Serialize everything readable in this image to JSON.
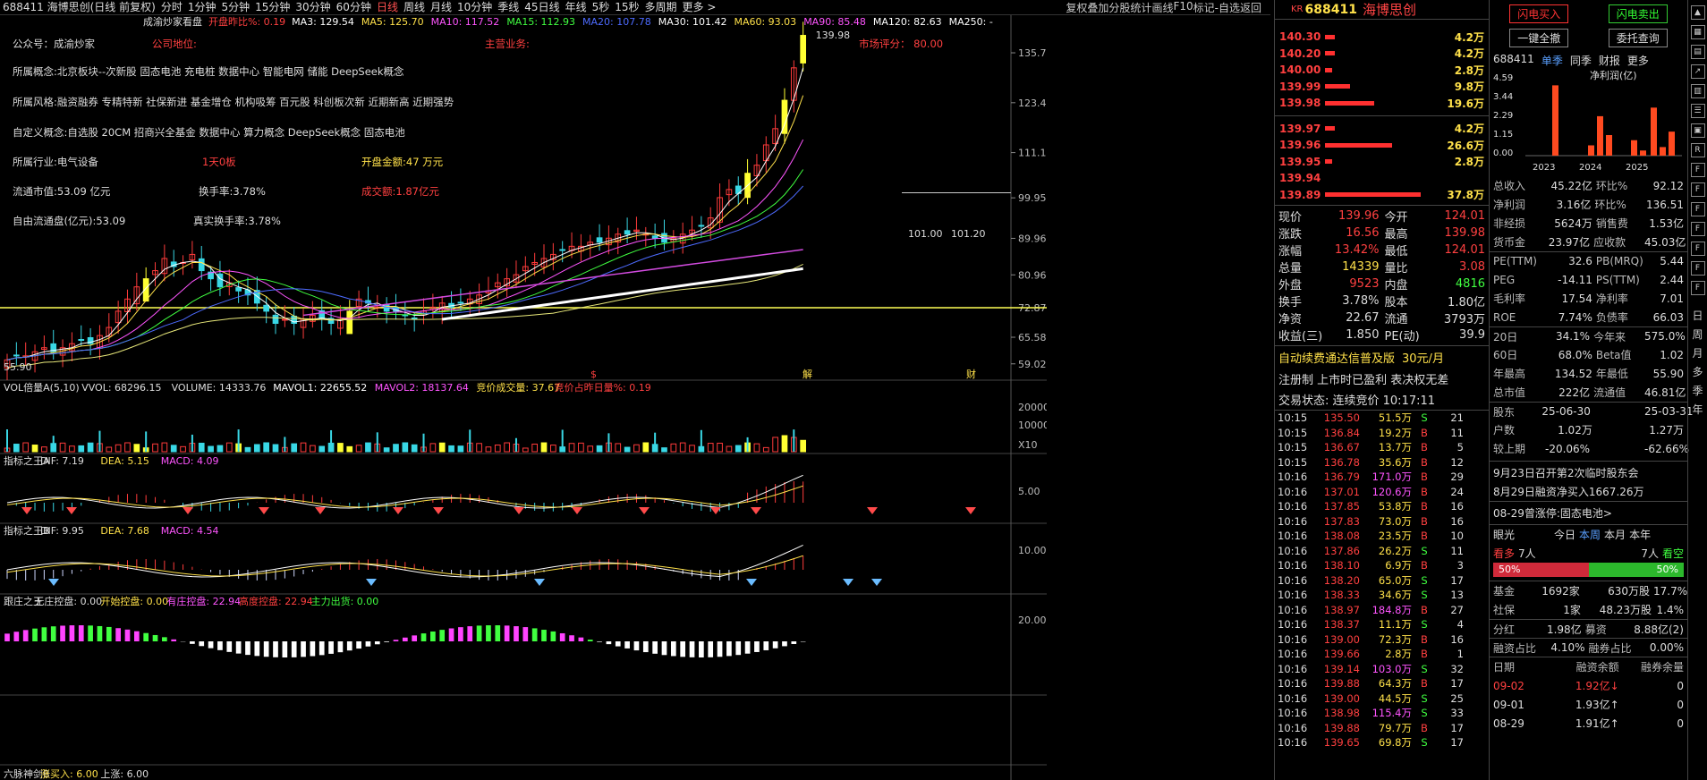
{
  "topbar": {
    "title": "688411 海博思创(日线 前复权)",
    "periods": [
      "分时",
      "1分钟",
      "5分钟",
      "15分钟",
      "30分钟",
      "60分钟",
      "日线",
      "周线",
      "月线",
      "10分钟",
      "季线",
      "45日线",
      "年线",
      "5秒",
      "15秒",
      "多周期",
      "更多 >"
    ],
    "active_period": "日线",
    "buttons": [
      "复权",
      "叠加",
      "分股",
      "统计",
      "画线",
      "F10",
      "标记",
      "-自选",
      "返回"
    ]
  },
  "ma_line": {
    "name": "成渝炒家看盘",
    "open_chg": "开盘昨比%: 0.19",
    "items": [
      {
        "text": "MA3: 129.54",
        "color": "#ffffff"
      },
      {
        "text": "MA5: 125.70",
        "color": "#ffe14a"
      },
      {
        "text": "MA10: 117.52",
        "color": "#ff55ff"
      },
      {
        "text": "MA15: 112.93",
        "color": "#40ff40"
      },
      {
        "text": "MA20: 107.78",
        "color": "#4d6bff"
      },
      {
        "text": "MA30: 101.42",
        "color": "#ffffff"
      },
      {
        "text": "MA60: 93.03",
        "color": "#ffe14a"
      },
      {
        "text": "MA90: 85.48",
        "color": "#ff55ff"
      },
      {
        "text": "MA120: 82.63",
        "color": "#ffffff"
      },
      {
        "text": "MA250: -",
        "color": "#ffffff"
      }
    ]
  },
  "info": {
    "public": "公众号：成渝炒家",
    "company_status": "公司地位:",
    "main_business": "主营业务:",
    "market_score": "市场评分： 80.00",
    "concept": "所属概念:北京板块--次新股 固态电池 充电桩 数据中心 智能电网 储能 DeepSeek概念",
    "style": "所属风格:融资融券 专精特新 社保新进 基金增仓 机构吸筹 百元股 科创板次新 近期新高 近期强势",
    "custom": "自定义概念:自选股 20CM 招商兴全基金 数据中心 算力概念 DeepSeek概念 固态电池",
    "industry": "所属行业:电气设备",
    "board": "1天0板",
    "open_amount": "开盘金额:47 万元",
    "circ_mv": "流通市值:53.09 亿元",
    "turnover": "换手率:3.78%",
    "amount": "成交额:1.87亿元",
    "free_circ": "自由流通盘(亿元):53.09",
    "real_turnover": "真实换手率:3.78%"
  },
  "price_axis": [
    "135.7",
    "123.4",
    "111.1",
    "99.95",
    "89.96",
    "80.96",
    "72.87",
    "65.58",
    "59.02"
  ],
  "chart_annotations": {
    "high": "139.98",
    "low": "55.90",
    "mark1": "101.00",
    "mark2": "101.20",
    "event_s": "$",
    "event_jie": "解",
    "event_cai": "财"
  },
  "vol_panel": {
    "header": [
      {
        "text": "VOL倍量A(5,10)",
        "color": "#dddddd"
      },
      {
        "text": "VVOL: 68296.15",
        "color": "#dddddd"
      },
      {
        "text": "VOLUME: 14333.76",
        "color": "#dddddd"
      },
      {
        "text": "MAVOL1: 22655.52",
        "color": "#ffffff"
      },
      {
        "text": "MAVOL2: 18137.64",
        "color": "#ff55ff"
      },
      {
        "text": "竞价成交量: 37.67",
        "color": "#ffe14a"
      },
      {
        "text": "竞价占昨日量%: 0.19",
        "color": "#ff4040"
      }
    ],
    "axis": [
      "20000",
      "10000",
      "X10"
    ]
  },
  "macd_a": {
    "header": [
      {
        "text": "指标之王A",
        "color": "#dddddd"
      },
      {
        "text": "DIF: 7.19",
        "color": "#dddddd"
      },
      {
        "text": "DEA: 5.15",
        "color": "#ffe14a"
      },
      {
        "text": "MACD: 4.09",
        "color": "#ff55ff"
      }
    ],
    "axis": "5.00"
  },
  "macd_b": {
    "header": [
      {
        "text": "指标之王B",
        "color": "#dddddd"
      },
      {
        "text": "DIF: 9.95",
        "color": "#dddddd"
      },
      {
        "text": "DEA: 7.68",
        "color": "#ffe14a"
      },
      {
        "text": "MACD: 4.54",
        "color": "#ff55ff"
      }
    ],
    "axis": "10.00"
  },
  "zhuang": {
    "header": [
      {
        "text": "跟庄之王",
        "color": "#dddddd"
      },
      {
        "text": "无庄控盘: 0.00",
        "color": "#dddddd"
      },
      {
        "text": "开始控盘: 0.00",
        "color": "#ffe14a"
      },
      {
        "text": "有庄控盘: 22.94",
        "color": "#ff55ff"
      },
      {
        "text": "高度控盘: 22.94",
        "color": "#ff4040"
      },
      {
        "text": "主力出货: 0.00",
        "color": "#40ff40"
      }
    ],
    "axis": "20.00"
  },
  "liumai": {
    "header": [
      {
        "text": "六脉神剑B",
        "color": "#dddddd"
      },
      {
        "text": "涨买入: 6.00",
        "color": "#ffe14a"
      },
      {
        "text": "上涨: 6.00",
        "color": "#dddddd"
      }
    ]
  },
  "orderbook": {
    "code_label": "KR",
    "code": "688411",
    "name": "海博思创",
    "asks": [
      {
        "price": "140.30",
        "vol": "4.2万",
        "bar": 0.1
      },
      {
        "price": "140.20",
        "vol": "4.2万",
        "bar": 0.1
      },
      {
        "price": "140.00",
        "vol": "2.8万",
        "bar": 0.07
      },
      {
        "price": "139.99",
        "vol": "9.8万",
        "bar": 0.25
      },
      {
        "price": "139.98",
        "vol": "19.6万",
        "bar": 0.5
      }
    ],
    "bids": [
      {
        "price": "139.97",
        "vol": "4.2万",
        "bar": 0.1
      },
      {
        "price": "139.96",
        "vol": "26.6万",
        "bar": 0.68
      },
      {
        "price": "139.95",
        "vol": "2.8万",
        "bar": 0.07
      },
      {
        "price": "139.94",
        "vol": "",
        "bar": 0
      },
      {
        "price": "139.89",
        "vol": "37.8万",
        "bar": 0.97
      }
    ],
    "quote": [
      [
        "现价",
        "139.96",
        "今开",
        "124.01"
      ],
      [
        "涨跌",
        "16.56",
        "最高",
        "139.98"
      ],
      [
        "涨幅",
        "13.42%",
        "最低",
        "124.01"
      ],
      [
        "总量",
        "14339",
        "量比",
        "3.08"
      ],
      [
        "外盘",
        "9523",
        "内盘",
        "4816"
      ],
      [
        "换手",
        "3.78%",
        "股本",
        "1.80亿"
      ],
      [
        "净资",
        "22.67",
        "流通",
        "3793万"
      ],
      [
        "收益(三)",
        "1.850",
        "PE(动)",
        "39.9"
      ]
    ],
    "promo": "自动续费通达信普及版",
    "promo_price": "30元/月",
    "reg_note": "注册制 上市时已盈利 表决权无差",
    "status": "交易状态: 连续竞价 10:17:11",
    "ticks": [
      [
        "10:15",
        "135.50",
        "51.5万",
        "S",
        "21"
      ],
      [
        "10:15",
        "136.84",
        "19.2万",
        "B",
        "11"
      ],
      [
        "10:15",
        "136.67",
        "13.7万",
        "B",
        "5"
      ],
      [
        "10:15",
        "136.78",
        "35.6万",
        "B",
        "12"
      ],
      [
        "10:16",
        "136.79",
        "171.0万",
        "B",
        "29"
      ],
      [
        "10:16",
        "137.01",
        "120.6万",
        "B",
        "24"
      ],
      [
        "10:16",
        "137.85",
        "53.8万",
        "B",
        "16"
      ],
      [
        "10:16",
        "137.83",
        "73.0万",
        "B",
        "16"
      ],
      [
        "10:16",
        "138.08",
        "23.5万",
        "B",
        "10"
      ],
      [
        "10:16",
        "137.86",
        "26.2万",
        "S",
        "11"
      ],
      [
        "10:16",
        "138.10",
        "6.9万",
        "B",
        "3"
      ],
      [
        "10:16",
        "138.20",
        "65.0万",
        "S",
        "17"
      ],
      [
        "10:16",
        "138.33",
        "34.6万",
        "S",
        "13"
      ],
      [
        "10:16",
        "138.97",
        "184.8万",
        "B",
        "27"
      ],
      [
        "10:16",
        "138.37",
        "11.1万",
        "S",
        "4"
      ],
      [
        "10:16",
        "139.00",
        "72.3万",
        "B",
        "16"
      ],
      [
        "10:16",
        "139.66",
        "2.8万",
        "B",
        "1"
      ],
      [
        "10:16",
        "139.14",
        "103.0万",
        "S",
        "32"
      ],
      [
        "10:16",
        "139.88",
        "64.3万",
        "B",
        "17"
      ],
      [
        "10:16",
        "139.00",
        "44.5万",
        "S",
        "25"
      ],
      [
        "10:16",
        "138.98",
        "115.4万",
        "S",
        "33"
      ],
      [
        "10:16",
        "139.88",
        "79.7万",
        "B",
        "17"
      ],
      [
        "10:16",
        "139.65",
        "69.8万",
        "S",
        "17"
      ]
    ]
  },
  "fpanel": {
    "btn_buy": "闪电买入",
    "btn_sell": "闪电卖出",
    "btn_all": "一键全撤",
    "btn_query": "委托查询",
    "tabs": [
      "688411",
      "单季",
      "同季",
      "财报",
      "更多"
    ],
    "chart_title": "净利润(亿)",
    "chart_y": [
      "4.59",
      "3.44",
      "2.29",
      "1.15",
      "0.00"
    ],
    "chart_x": [
      "2023",
      "2024",
      "2025"
    ],
    "chart_bars": [
      4.1,
      0.6,
      2.3,
      1.2,
      0.9,
      0.3,
      2.8,
      0.5,
      1.4
    ],
    "fin": [
      [
        "总收入",
        "45.22亿",
        "环比%",
        "92.12"
      ],
      [
        "净利润",
        "3.16亿",
        "环比%",
        "136.51"
      ],
      [
        "非经损",
        "5624万",
        "销售费",
        "1.53亿"
      ],
      [
        "货币金",
        "23.97亿",
        "应收款",
        "45.03亿"
      ],
      [
        "PE(TTM)",
        "32.6",
        "PB(MRQ)",
        "5.44"
      ],
      [
        "PEG",
        "-14.11",
        "PS(TTM)",
        "2.44"
      ],
      [
        "毛利率",
        "17.54",
        "净利率",
        "7.01"
      ],
      [
        "ROE",
        "7.74%",
        "负债率",
        "66.03"
      ],
      [
        "20日",
        "34.1%",
        "今年来",
        "575.0%"
      ],
      [
        "60日",
        "68.0%",
        "Beta值",
        "1.02"
      ],
      [
        "年最高",
        "134.52",
        "年最低",
        "55.90"
      ],
      [
        "总市值",
        "222亿",
        "流通值",
        "46.81亿"
      ],
      [
        "股东",
        "25-06-30",
        "",
        "25-03-31"
      ],
      [
        "户数",
        "1.02万",
        "",
        "1.27万"
      ],
      [
        "较上期",
        "-20.06%",
        "",
        "-62.66%"
      ]
    ],
    "news": [
      "9月23日召开第2次临时股东会",
      "8月29日融资净买入1667.26万"
    ],
    "limit_note": "08-29曾涨停:固态电池>",
    "eye": {
      "label": "眼光",
      "tabs": [
        "今日",
        "本周",
        "本月",
        "本年"
      ],
      "bull": "看多",
      "bull_n": "7人",
      "bear_n": "7人",
      "bear": "看空",
      "bull_pct": "50%",
      "bear_pct": "50%"
    },
    "holders": [
      [
        "基金",
        "1692家",
        "630万股",
        "17.7%"
      ],
      [
        "社保",
        "1家",
        "48.23万股",
        "1.4%"
      ]
    ],
    "split": [
      "分红",
      "1.98亿",
      "募资",
      "8.88亿(2)"
    ],
    "margin_ratio": [
      "融资占比",
      "4.10%",
      "融券占比",
      "0.00%"
    ],
    "margin_head": [
      "日期",
      "融资余额",
      "融券余量"
    ],
    "margin_rows": [
      [
        "09-02",
        "1.92亿↓",
        "0"
      ],
      [
        "09-01",
        "1.93亿↑",
        "0"
      ],
      [
        "08-29",
        "1.91亿↑",
        "0"
      ]
    ]
  },
  "sidebar": {
    "labels": [
      "日",
      "周",
      "月",
      "多",
      "季",
      "年"
    ]
  },
  "chart_data": {
    "type": "candlestick",
    "closes": [
      60,
      61,
      61,
      62,
      63,
      62,
      63,
      64,
      65,
      64,
      66,
      68,
      72,
      75,
      78,
      80,
      82,
      85,
      83,
      84,
      86,
      82,
      80,
      78,
      79,
      77,
      76,
      74,
      72,
      69,
      70,
      69,
      70,
      71,
      70,
      69,
      70,
      72,
      75,
      74,
      73,
      72,
      72,
      71,
      70,
      72,
      73,
      74,
      73,
      74,
      75,
      76,
      77,
      79,
      80,
      81,
      83,
      84,
      85,
      86,
      87,
      88,
      88,
      89,
      89,
      90,
      91,
      91,
      92,
      91,
      90,
      89,
      90,
      91,
      92,
      93,
      95,
      100,
      102,
      101,
      106,
      108,
      113,
      117,
      124,
      132,
      140
    ],
    "ma_series": [
      {
        "name": "MA5"
      },
      {
        "name": "MA10"
      },
      {
        "name": "MA20"
      },
      {
        "name": "MA60"
      },
      {
        "name": "MA120"
      }
    ],
    "price_range": [
      55.9,
      139.98
    ]
  }
}
